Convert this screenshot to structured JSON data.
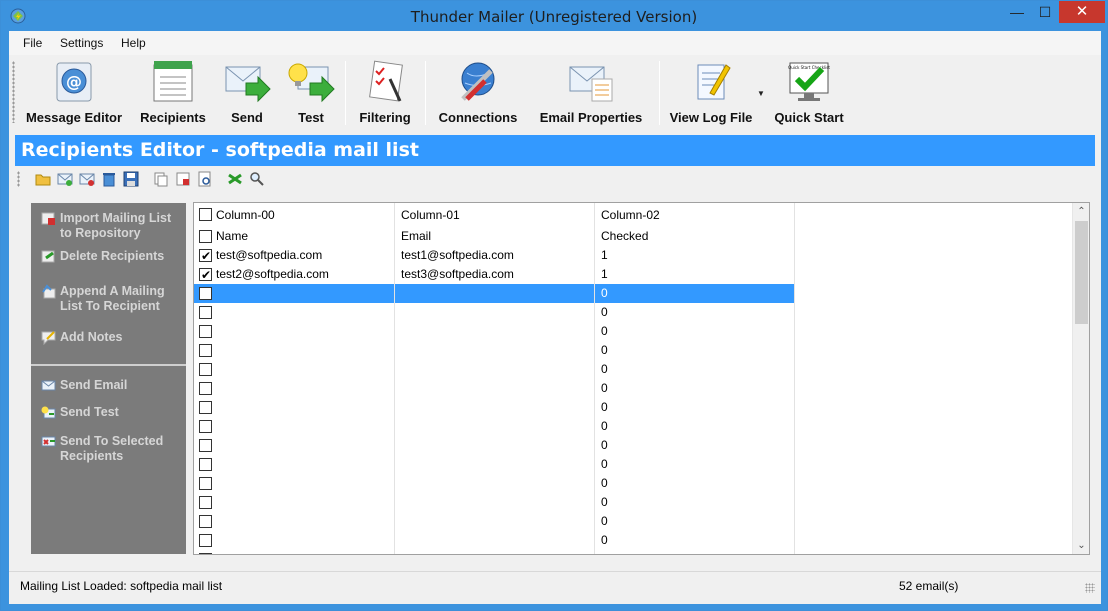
{
  "window": {
    "title": "Thunder Mailer (Unregistered Version)",
    "minimize": "—",
    "maximize": "☐",
    "close": "✕"
  },
  "menu": [
    "File",
    "Settings",
    "Help"
  ],
  "toolbar": {
    "message_editor": "Message Editor",
    "recipients": "Recipients",
    "send": "Send",
    "test": "Test",
    "filtering": "Filtering",
    "connections": "Connections",
    "email_properties": "Email Properties",
    "view_log_file": "View Log File",
    "quick_start": "Quick Start",
    "quick_start_checklist": "Quick Start Checklist"
  },
  "banner": "Recipients Editor - softpedia mail list",
  "left_panel": {
    "import": "Import Mailing List to Repository",
    "delete": "Delete Recipients",
    "append": "Append A Mailing List To Recipient",
    "notes": "Add Notes",
    "send_email": "Send Email",
    "send_test": "Send Test",
    "send_selected": "Send To Selected Recipients"
  },
  "grid": {
    "columns": [
      "Column-00",
      "Column-01",
      "Column-02"
    ],
    "rows": [
      {
        "checked": false,
        "c0": "Name",
        "c1": "Email",
        "c2": "Checked"
      },
      {
        "checked": true,
        "c0": "test@softpedia.com",
        "c1": "test1@softpedia.com",
        "c2": "1"
      },
      {
        "checked": true,
        "c0": "test2@softpedia.com",
        "c1": "test3@softpedia.com",
        "c2": "1"
      },
      {
        "checked": false,
        "c0": "",
        "c1": "",
        "c2": "0",
        "selected": true
      },
      {
        "checked": false,
        "c0": "",
        "c1": "",
        "c2": "0"
      },
      {
        "checked": false,
        "c0": "",
        "c1": "",
        "c2": "0"
      },
      {
        "checked": false,
        "c0": "",
        "c1": "",
        "c2": "0"
      },
      {
        "checked": false,
        "c0": "",
        "c1": "",
        "c2": "0"
      },
      {
        "checked": false,
        "c0": "",
        "c1": "",
        "c2": "0"
      },
      {
        "checked": false,
        "c0": "",
        "c1": "",
        "c2": "0"
      },
      {
        "checked": false,
        "c0": "",
        "c1": "",
        "c2": "0"
      },
      {
        "checked": false,
        "c0": "",
        "c1": "",
        "c2": "0"
      },
      {
        "checked": false,
        "c0": "",
        "c1": "",
        "c2": "0"
      },
      {
        "checked": false,
        "c0": "",
        "c1": "",
        "c2": "0"
      },
      {
        "checked": false,
        "c0": "",
        "c1": "",
        "c2": "0"
      },
      {
        "checked": false,
        "c0": "",
        "c1": "",
        "c2": "0"
      },
      {
        "checked": false,
        "c0": "",
        "c1": "",
        "c2": "0"
      },
      {
        "checked": false,
        "c0": "",
        "c1": "",
        "c2": "0"
      }
    ]
  },
  "status": {
    "left": "Mailing List Loaded: softpedia mail list",
    "right": "52 email(s)"
  },
  "colors": {
    "title_bar": "#3c93de",
    "banner": "#3399ff",
    "close_button": "#c7372d",
    "left_panel": "#7b7b7b",
    "selection": "#3399ff"
  }
}
